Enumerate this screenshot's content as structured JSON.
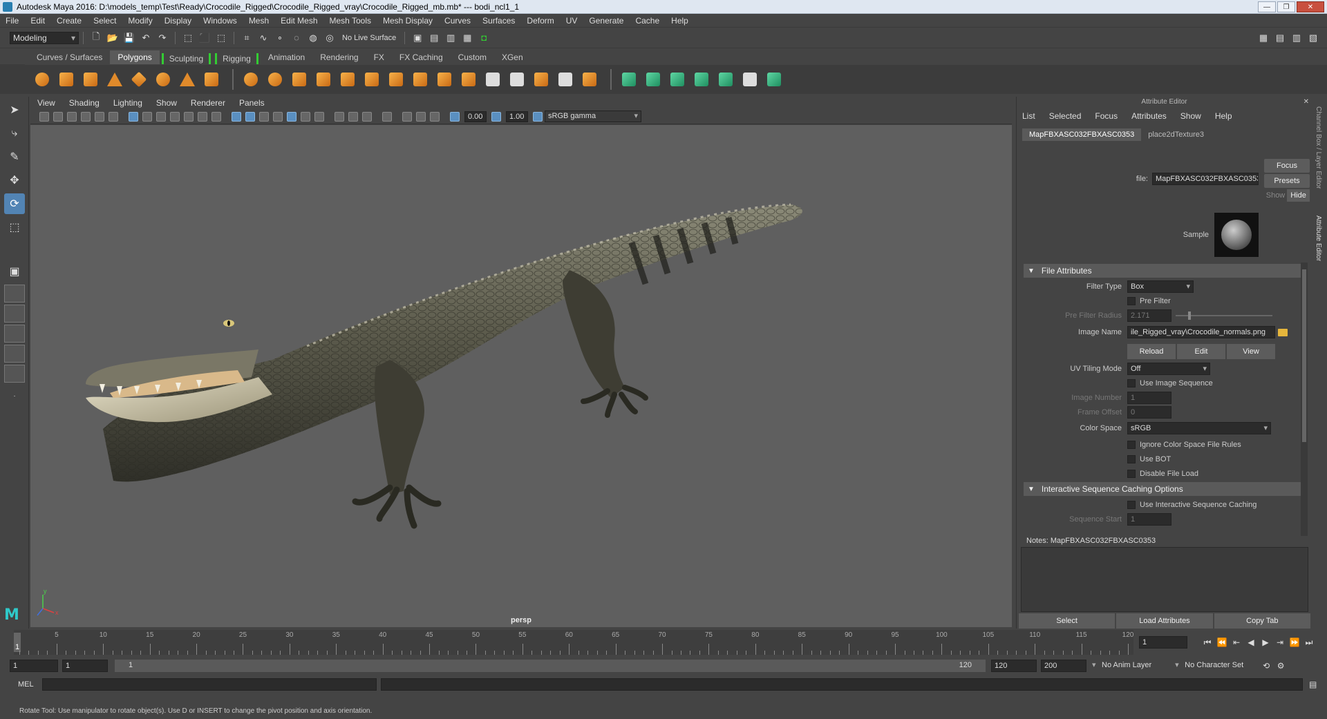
{
  "window": {
    "title": "Autodesk Maya 2016: D:\\models_temp\\Test\\Ready\\Crocodile_Rigged\\Crocodile_Rigged_vray\\Crocodile_Rigged_mb.mb*   ---   bodi_ncl1_1",
    "controls": {
      "minimize": "—",
      "maximize": "❐",
      "close": "✕"
    }
  },
  "menubar": [
    "File",
    "Edit",
    "Create",
    "Select",
    "Modify",
    "Display",
    "Windows",
    "Mesh",
    "Edit Mesh",
    "Mesh Tools",
    "Mesh Display",
    "Curves",
    "Surfaces",
    "Deform",
    "UV",
    "Generate",
    "Cache",
    "Help"
  ],
  "statusline": {
    "mode": "Modeling",
    "live_surface": "No Live Surface"
  },
  "shelf": {
    "tabs": [
      {
        "label": "Curves / Surfaces",
        "active": false,
        "bracket": false
      },
      {
        "label": "Polygons",
        "active": true,
        "bracket": false
      },
      {
        "label": "Sculpting",
        "active": false,
        "bracket": true
      },
      {
        "label": "Rigging",
        "active": false,
        "bracket": true
      },
      {
        "label": "Animation",
        "active": false,
        "bracket": false
      },
      {
        "label": "Rendering",
        "active": false,
        "bracket": false
      },
      {
        "label": "FX",
        "active": false,
        "bracket": false
      },
      {
        "label": "FX Caching",
        "active": false,
        "bracket": false
      },
      {
        "label": "Custom",
        "active": false,
        "bracket": false
      },
      {
        "label": "XGen",
        "active": false,
        "bracket": false
      }
    ]
  },
  "viewport": {
    "menu": [
      "View",
      "Shading",
      "Lighting",
      "Show",
      "Renderer",
      "Panels"
    ],
    "exposure": "0.00",
    "gamma": "1.00",
    "color_space": "sRGB gamma",
    "camera_label": "persp",
    "axis_y": "y",
    "axis_x": "x"
  },
  "attribute_editor": {
    "title": "Attribute Editor",
    "close": "✕",
    "menu": [
      "List",
      "Selected",
      "Focus",
      "Attributes",
      "Show",
      "Help"
    ],
    "tabs": [
      {
        "label": "MapFBXASC032FBXASC0353",
        "active": true
      },
      {
        "label": "place2dTexture3",
        "active": false
      }
    ],
    "file_label": "file:",
    "file_value": "MapFBXASC032FBXASC0353",
    "focus_btn": "Focus",
    "presets_btn": "Presets",
    "show_btn": "Show",
    "hide_btn": "Hide",
    "sample_label": "Sample",
    "sections": {
      "file_attributes": "File Attributes",
      "interactive": "Interactive Sequence Caching Options"
    },
    "filter_type_label": "Filter Type",
    "filter_type": "Box",
    "pre_filter": "Pre Filter",
    "pre_filter_radius_label": "Pre Filter Radius",
    "pre_filter_radius": "2.171",
    "image_name_label": "Image Name",
    "image_name": "ile_Rigged_vray\\Crocodile_normals.png",
    "reload_btn": "Reload",
    "edit_btn": "Edit",
    "view_btn": "View",
    "uv_tiling_label": "UV Tiling Mode",
    "uv_tiling": "Off",
    "use_image_sequence": "Use Image Sequence",
    "image_number_label": "Image Number",
    "image_number": "1",
    "frame_offset_label": "Frame Offset",
    "frame_offset": "0",
    "color_space_label": "Color Space",
    "color_space": "sRGB",
    "ignore_cs_rules": "Ignore Color Space File Rules",
    "use_bot": "Use BOT",
    "disable_file_load": "Disable File Load",
    "use_interactive": "Use Interactive Sequence Caching",
    "sequence_start_label": "Sequence Start",
    "sequence_start": "1",
    "notes": "Notes:  MapFBXASC032FBXASC0353",
    "bottom": {
      "select": "Select",
      "load": "Load Attributes",
      "copy": "Copy Tab"
    },
    "side_labels": {
      "channel": "Channel Box / Layer Editor",
      "ae": "Attribute Editor"
    }
  },
  "timeline": {
    "ticks": [
      "5",
      "10",
      "15",
      "20",
      "25",
      "30",
      "35",
      "40",
      "45",
      "50",
      "55",
      "60",
      "65",
      "70",
      "75",
      "80",
      "85",
      "90",
      "95",
      "100",
      "105",
      "110",
      "115",
      "120"
    ],
    "current_frame": "1",
    "current_field": "1"
  },
  "range": {
    "start": "1",
    "playback_start": "1",
    "slider_start": "1",
    "slider_end": "120",
    "playback_end": "120",
    "end": "200",
    "anim_layer": "No Anim Layer",
    "character_set": "No Character Set"
  },
  "cmdline": {
    "label": "MEL"
  },
  "helpline": "Rotate Tool: Use manipulator to rotate object(s). Use D or INSERT to change the pivot position and axis orientation."
}
